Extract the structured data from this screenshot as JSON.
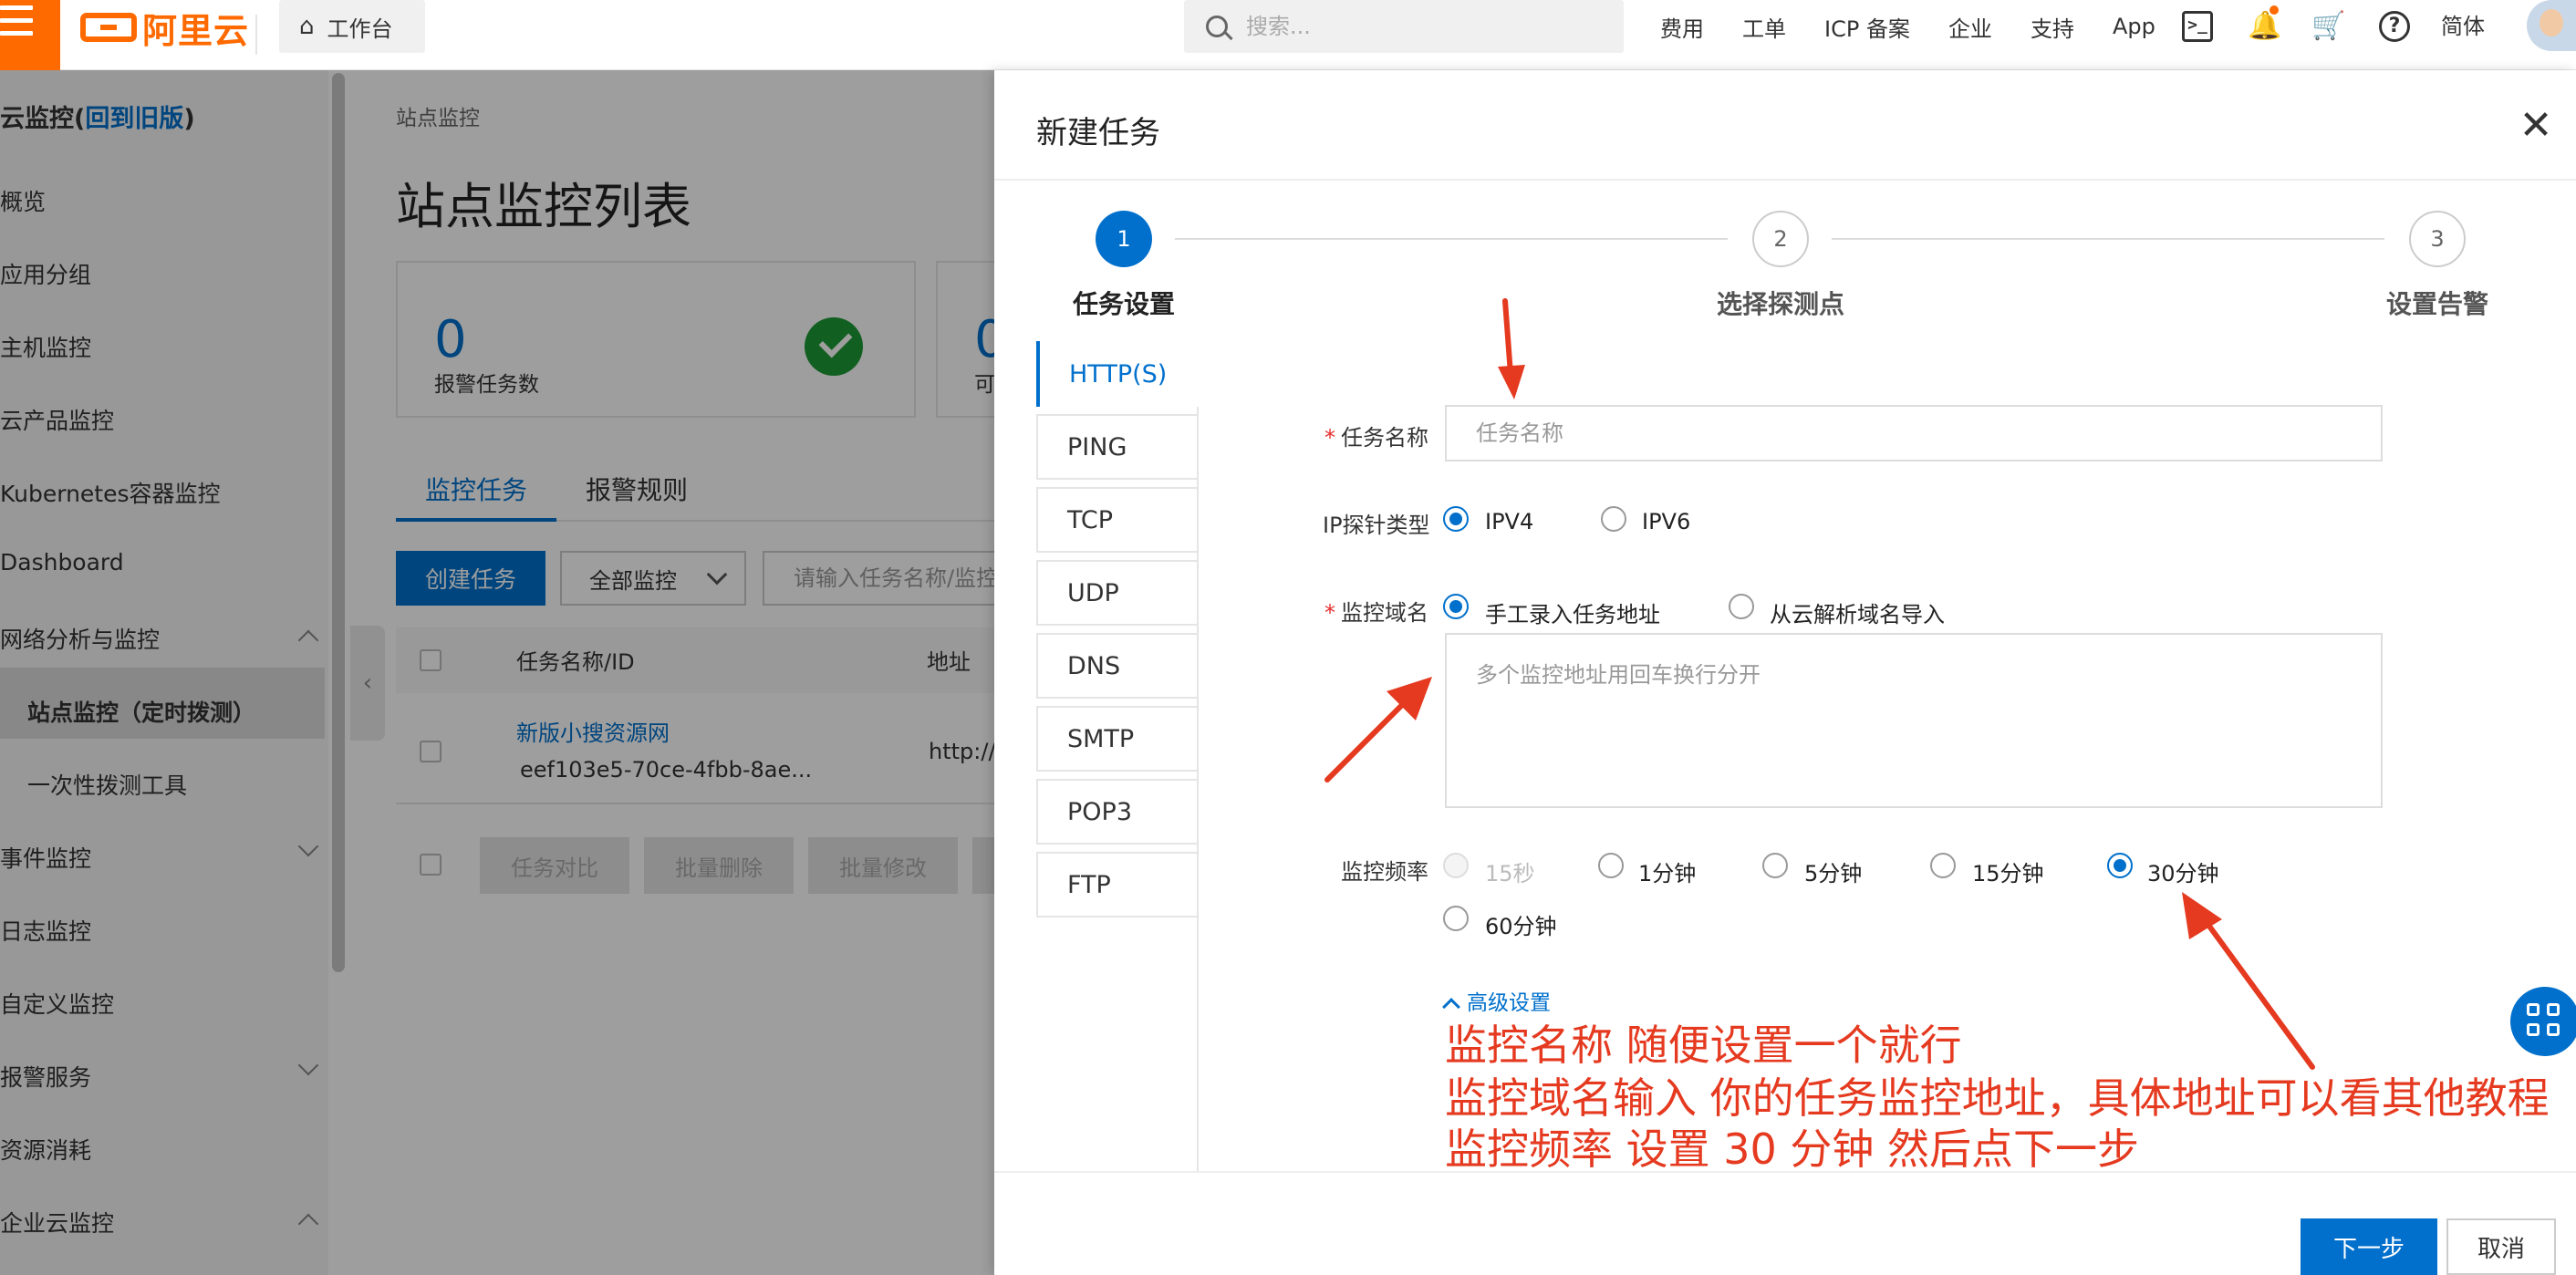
{
  "topbar": {
    "logo_text": "阿里云",
    "workbench": "工作台",
    "search_placeholder": "搜索...",
    "nav": [
      "费用",
      "工单",
      "ICP 备案",
      "企业",
      "支持",
      "App"
    ],
    "terminal_icon": ">_",
    "help_icon": "?",
    "lang": "简体"
  },
  "sidebar": {
    "title_prefix": "云监控(",
    "title_link": "回到旧版",
    "title_suffix": ")",
    "items": [
      "概览",
      "应用分组",
      "主机监控",
      "云产品监控",
      "Kubernetes容器监控",
      "Dashboard",
      "网络分析与监控",
      "站点监控（定时拨测）",
      "一次性拨测工具",
      "事件监控",
      "日志监控",
      "自定义监控",
      "报警服务",
      "资源消耗",
      "企业云监控"
    ]
  },
  "main": {
    "breadcrumb": "站点监控",
    "title": "站点监控列表",
    "cards": [
      {
        "value": "0",
        "label": "报警任务数"
      },
      {
        "value": "0",
        "label": "可"
      }
    ],
    "tabs": [
      "监控任务",
      "报警规则"
    ],
    "create_button": "创建任务",
    "filter_select": "全部监控",
    "search_placeholder": "请输入任务名称/监控",
    "columns": [
      "任务名称/ID",
      "地址"
    ],
    "row": {
      "name": "新版小搜资源网",
      "id": "eef103e5-70ce-4fbb-8ae...",
      "address": "http://"
    },
    "bulk_buttons": [
      "任务对比",
      "批量删除",
      "批量修改"
    ]
  },
  "drawer": {
    "title": "新建任务",
    "close": "✕",
    "steps": [
      {
        "num": "1",
        "label": "任务设置"
      },
      {
        "num": "2",
        "label": "选择探测点"
      },
      {
        "num": "3",
        "label": "设置告警"
      }
    ],
    "protocols": [
      "HTTP(S)",
      "PING",
      "TCP",
      "UDP",
      "DNS",
      "SMTP",
      "POP3",
      "FTP"
    ],
    "task_name_label": "任务名称",
    "task_name_placeholder": "任务名称",
    "ip_type_label": "IP探针类型",
    "ip_options": [
      "IPV4",
      "IPV6"
    ],
    "domain_label": "监控域名",
    "domain_options": [
      "手工录入任务地址",
      "从云解析域名导入"
    ],
    "domain_placeholder": "多个监控地址用回车换行分开",
    "freq_label": "监控频率",
    "freq_options": [
      "15秒",
      "1分钟",
      "5分钟",
      "15分钟",
      "30分钟",
      "60分钟"
    ],
    "advanced": "高级设置",
    "next_button": "下一步",
    "cancel_button": "取消",
    "required_mark": "*"
  },
  "annotations": [
    "监控名称 随便设置一个就行",
    "监控域名输入 你的任务监控地址，具体地址可以看其他教程",
    "监控频率 设置 30 分钟 然后点下一步"
  ],
  "colors": {
    "brand": "#ff6a00",
    "primary": "#0070cc",
    "annotation": "#e53a20",
    "success": "#1e9b36"
  }
}
